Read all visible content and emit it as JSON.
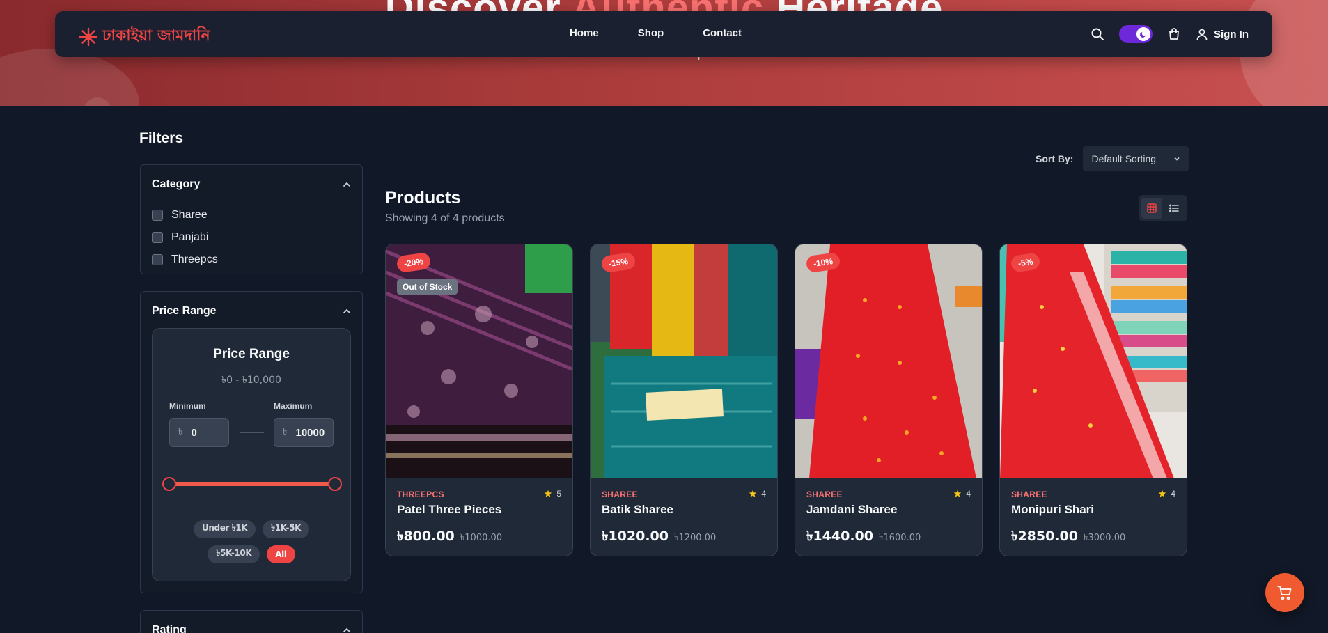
{
  "hero": {
    "title_start": "Discover",
    "title_accent": "Authentic",
    "title_end": "Heritage",
    "subtitle": "Craftsmanship"
  },
  "nav": {
    "logo_text": "ঢাকাইয়া জামদানি",
    "links": [
      "Home",
      "Shop",
      "Contact"
    ],
    "signin_label": "Sign In",
    "icons": [
      "search-icon",
      "theme-toggle",
      "cart-icon",
      "user-icon"
    ]
  },
  "filters": {
    "title": "Filters",
    "category": {
      "title": "Category",
      "items": [
        "Sharee",
        "Panjabi",
        "Threepcs"
      ]
    },
    "price": {
      "section_title": "Price Range",
      "card_title": "Price Range",
      "range_text": "৳0  -  ৳10,000",
      "min_label": "Minimum",
      "max_label": "Maximum",
      "currency": "৳",
      "min_value": "0",
      "max_value": "10000",
      "slider_low_fraction": 0,
      "slider_high_fraction": 1,
      "chips_row1": [
        "Under ৳1K",
        "৳1K-5K"
      ],
      "chips_row2": [
        "৳5K-10K",
        "All"
      ],
      "active_chip": "All"
    },
    "rating": {
      "title": "Rating"
    }
  },
  "products": {
    "sort_label": "Sort By:",
    "sort_value": "Default Sorting",
    "title": "Products",
    "count_text": "Showing 4 of 4 products",
    "items": [
      {
        "discount": "-20%",
        "stock_badge": "Out of Stock",
        "category": "THREEPCS",
        "rating": "5",
        "name": "Patel Three Pieces",
        "price": "৳800.00",
        "old_price": "৳1000.00"
      },
      {
        "discount": "-15%",
        "stock_badge": "",
        "category": "SHAREE",
        "rating": "4",
        "name": "Batik Sharee",
        "price": "৳1020.00",
        "old_price": "৳1200.00"
      },
      {
        "discount": "-10%",
        "stock_badge": "",
        "category": "SHAREE",
        "rating": "4",
        "name": "Jamdani Sharee",
        "price": "৳1440.00",
        "old_price": "৳1600.00"
      },
      {
        "discount": "-5%",
        "stock_badge": "",
        "category": "SHAREE",
        "rating": "4",
        "name": "Monipuri Shari",
        "price": "৳2850.00",
        "old_price": "৳3000.00"
      }
    ]
  },
  "colors": {
    "accent": "#ef4444",
    "background": "#111827",
    "card": "#1f2937",
    "toggle": "#6d28d9",
    "fab": "#f05a30"
  }
}
